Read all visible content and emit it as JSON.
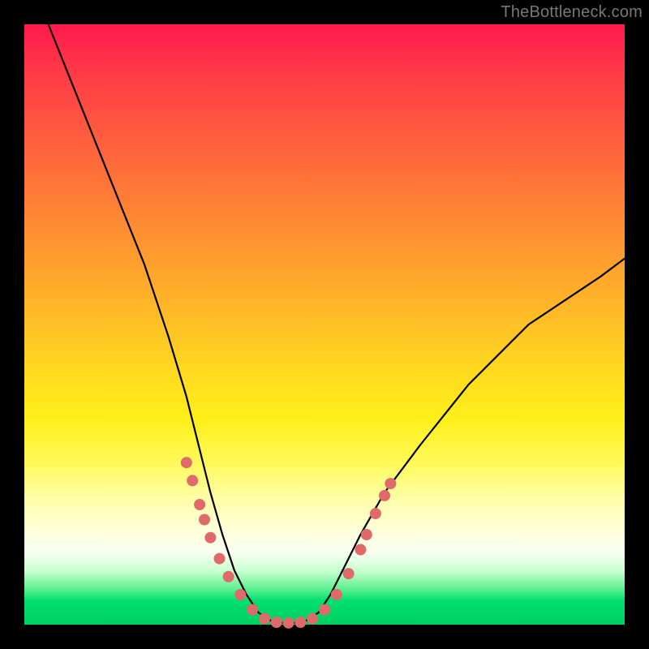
{
  "watermark": "TheBottleneck.com",
  "chart_data": {
    "type": "line",
    "title": "",
    "xlabel": "",
    "ylabel": "",
    "xlim": [
      0,
      100
    ],
    "ylim": [
      0,
      100
    ],
    "grid": false,
    "legend": false,
    "series": [
      {
        "name": "bottleneck-curve",
        "x": [
          4,
          8,
          12,
          16,
          20,
          24,
          27,
          29,
          31,
          33,
          35,
          37,
          39,
          41,
          43,
          45,
          47,
          49,
          51,
          53,
          56,
          60,
          66,
          74,
          84,
          96,
          100
        ],
        "y": [
          100,
          90,
          80,
          70,
          60,
          48,
          38,
          30,
          22,
          15,
          9,
          5,
          2,
          0.7,
          0.3,
          0.3,
          0.7,
          2,
          5,
          9,
          15,
          22,
          30,
          40,
          50,
          58,
          61
        ]
      }
    ],
    "markers": {
      "name": "sample-points",
      "color": "#e06a6a",
      "radius": 7,
      "points": [
        {
          "x": 27.0,
          "y": 27.0
        },
        {
          "x": 28.0,
          "y": 24.0
        },
        {
          "x": 29.2,
          "y": 20.0
        },
        {
          "x": 30.0,
          "y": 17.5
        },
        {
          "x": 31.0,
          "y": 14.5
        },
        {
          "x": 32.5,
          "y": 11.0
        },
        {
          "x": 34.0,
          "y": 8.0
        },
        {
          "x": 36.0,
          "y": 5.0
        },
        {
          "x": 38.0,
          "y": 2.5
        },
        {
          "x": 40.0,
          "y": 1.0
        },
        {
          "x": 42.0,
          "y": 0.4
        },
        {
          "x": 44.0,
          "y": 0.3
        },
        {
          "x": 46.0,
          "y": 0.4
        },
        {
          "x": 48.0,
          "y": 1.0
        },
        {
          "x": 50.0,
          "y": 2.5
        },
        {
          "x": 52.0,
          "y": 5.0
        },
        {
          "x": 54.0,
          "y": 8.5
        },
        {
          "x": 56.0,
          "y": 12.5
        },
        {
          "x": 57.0,
          "y": 15.0
        },
        {
          "x": 58.5,
          "y": 18.5
        },
        {
          "x": 60.0,
          "y": 21.5
        },
        {
          "x": 61.0,
          "y": 23.5
        }
      ]
    }
  }
}
